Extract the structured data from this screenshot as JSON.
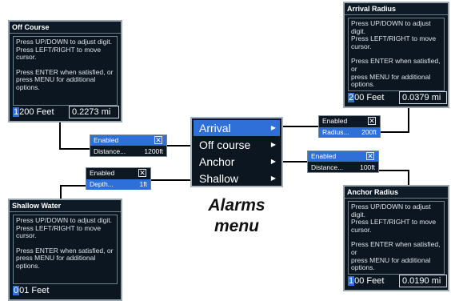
{
  "alarms_menu": {
    "items": [
      {
        "label": "Arrival"
      },
      {
        "label": "Off course"
      },
      {
        "label": "Anchor"
      },
      {
        "label": "Shallow"
      }
    ],
    "caption_line1": "Alarms",
    "caption_line2": "menu"
  },
  "help_text": {
    "line1": "Press UP/DOWN to adjust digit.",
    "line2": "Press LEFT/RIGHT to move cursor.",
    "line3": "Press ENTER when satisfied, or",
    "line4": "press MENU for additional options."
  },
  "off_course_dialog": {
    "title": "Off Course",
    "cursor_digit": "1",
    "value_rest": "200 Feet",
    "secondary": "0.2273 mi"
  },
  "arrival_dialog": {
    "title": "Arrival Radius",
    "cursor_digit": "2",
    "value_rest": "00 Feet",
    "secondary": "0.0379 mi"
  },
  "anchor_dialog": {
    "title": "Anchor Radius",
    "cursor_digit": "1",
    "value_rest": "00 Feet",
    "secondary": "0.0190 mi"
  },
  "shallow_dialog": {
    "title": "Shallow Water",
    "cursor_digit": "0",
    "value_rest": "01 Feet"
  },
  "off_course_popup": {
    "enabled_label": "Enabled",
    "setting_label": "Distance...",
    "setting_value": "1200ft"
  },
  "arrival_popup": {
    "enabled_label": "Enabled",
    "setting_label": "Radius...",
    "setting_value": "200ft"
  },
  "anchor_popup": {
    "enabled_label": "Enabled",
    "setting_label": "Distance...",
    "setting_value": "100ft"
  },
  "shallow_popup": {
    "enabled_label": "Enabled",
    "setting_label": "Depth...",
    "setting_value": "1ft"
  },
  "checkbox_glyph": "✕",
  "colors": {
    "selection_blue": "#2f6fd8",
    "dialog_bg": "#0b1620"
  }
}
